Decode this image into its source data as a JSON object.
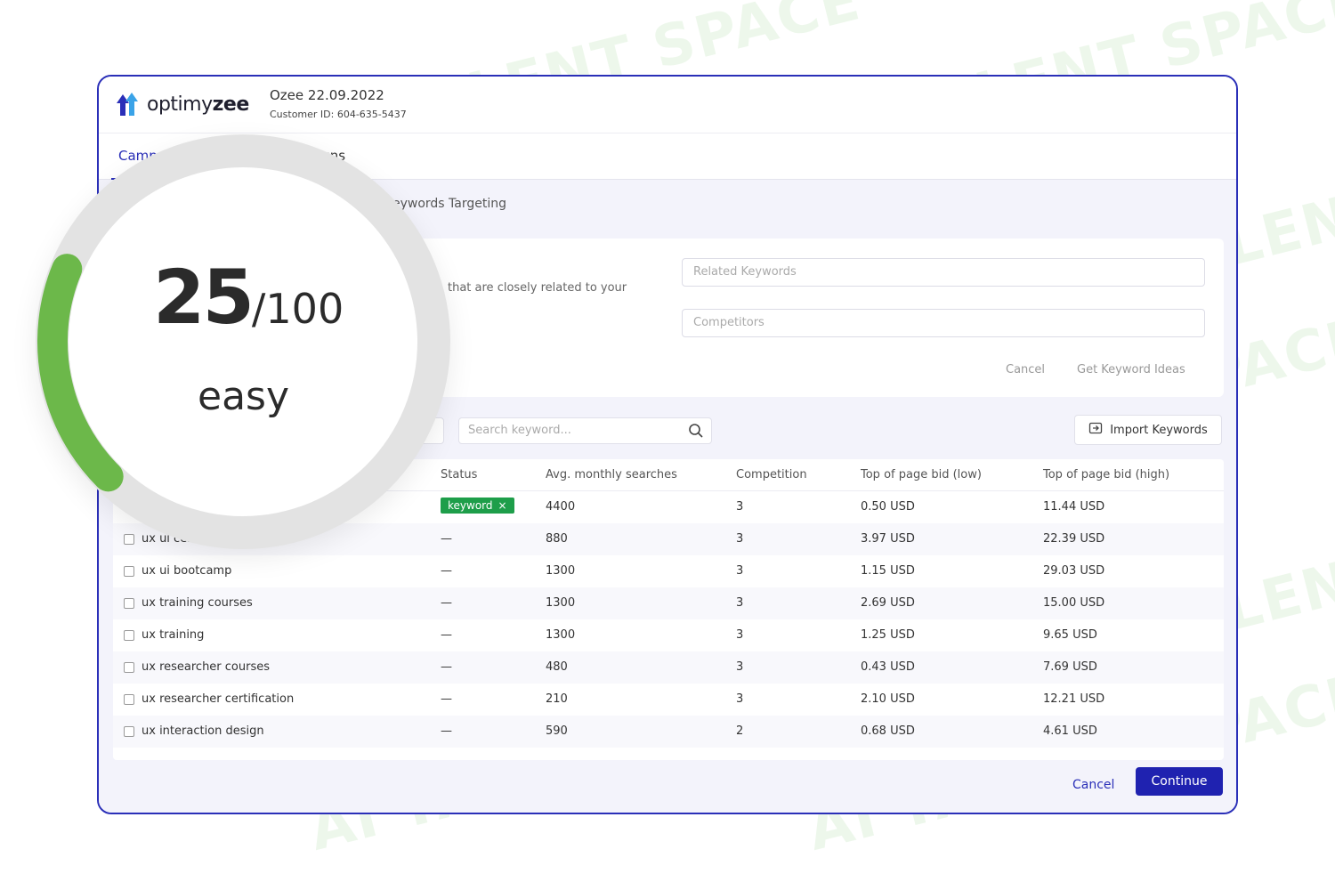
{
  "watermark": "AI TALENT SPACE",
  "app": {
    "logo_text_a": "optimy",
    "logo_text_b": "zee"
  },
  "account": {
    "name": "Ozee 22.09.2022",
    "customer_id": "Customer ID: 604-635-5437"
  },
  "tabs": [
    {
      "label": "Camp"
    },
    {
      "label": "igns"
    }
  ],
  "section": {
    "title": "eywords Targeting"
  },
  "ideas_panel": {
    "description": "that are closely related to your",
    "related_placeholder": "Related Keywords",
    "competitors_placeholder": "Competitors",
    "cancel_label": "Cancel",
    "get_ideas_label": "Get Keyword Ideas"
  },
  "toolbar": {
    "search_placeholder": "Search keyword...",
    "import_label": "Import Keywords"
  },
  "table": {
    "headers": [
      "Status",
      "Avg. monthly searches",
      "Competition",
      "Top of page bid (low)",
      "Top of page bid (high)"
    ],
    "rows": [
      {
        "keyword": "",
        "status": "keyword",
        "searches": "4400",
        "competition": "3",
        "low": "0.50 USD",
        "high": "11.44 USD"
      },
      {
        "keyword": "ux ui certificate",
        "status": "—",
        "searches": "880",
        "competition": "3",
        "low": "3.97 USD",
        "high": "22.39 USD"
      },
      {
        "keyword": "ux ui bootcamp",
        "status": "—",
        "searches": "1300",
        "competition": "3",
        "low": "1.15 USD",
        "high": "29.03 USD"
      },
      {
        "keyword": "ux training courses",
        "status": "—",
        "searches": "1300",
        "competition": "3",
        "low": "2.69 USD",
        "high": "15.00 USD"
      },
      {
        "keyword": "ux training",
        "status": "—",
        "searches": "1300",
        "competition": "3",
        "low": "1.25 USD",
        "high": "9.65 USD"
      },
      {
        "keyword": "ux researcher courses",
        "status": "—",
        "searches": "480",
        "competition": "3",
        "low": "0.43 USD",
        "high": "7.69 USD"
      },
      {
        "keyword": "ux researcher certification",
        "status": "—",
        "searches": "210",
        "competition": "3",
        "low": "2.10 USD",
        "high": "12.21 USD"
      },
      {
        "keyword": "ux interaction design",
        "status": "—",
        "searches": "590",
        "competition": "2",
        "low": "0.68 USD",
        "high": "4.61 USD"
      }
    ]
  },
  "footer": {
    "cancel_label": "Cancel",
    "continue_label": "Continue"
  },
  "score": {
    "value": "25",
    "max": "/100",
    "label": "easy",
    "fraction": 0.25
  },
  "colors": {
    "accent": "#2a2fb8",
    "badge": "#1e9e4a",
    "gauge": "#6cb84a"
  },
  "icons": [
    "logo-arrows-icon",
    "search-icon",
    "import-icon",
    "close-icon"
  ]
}
